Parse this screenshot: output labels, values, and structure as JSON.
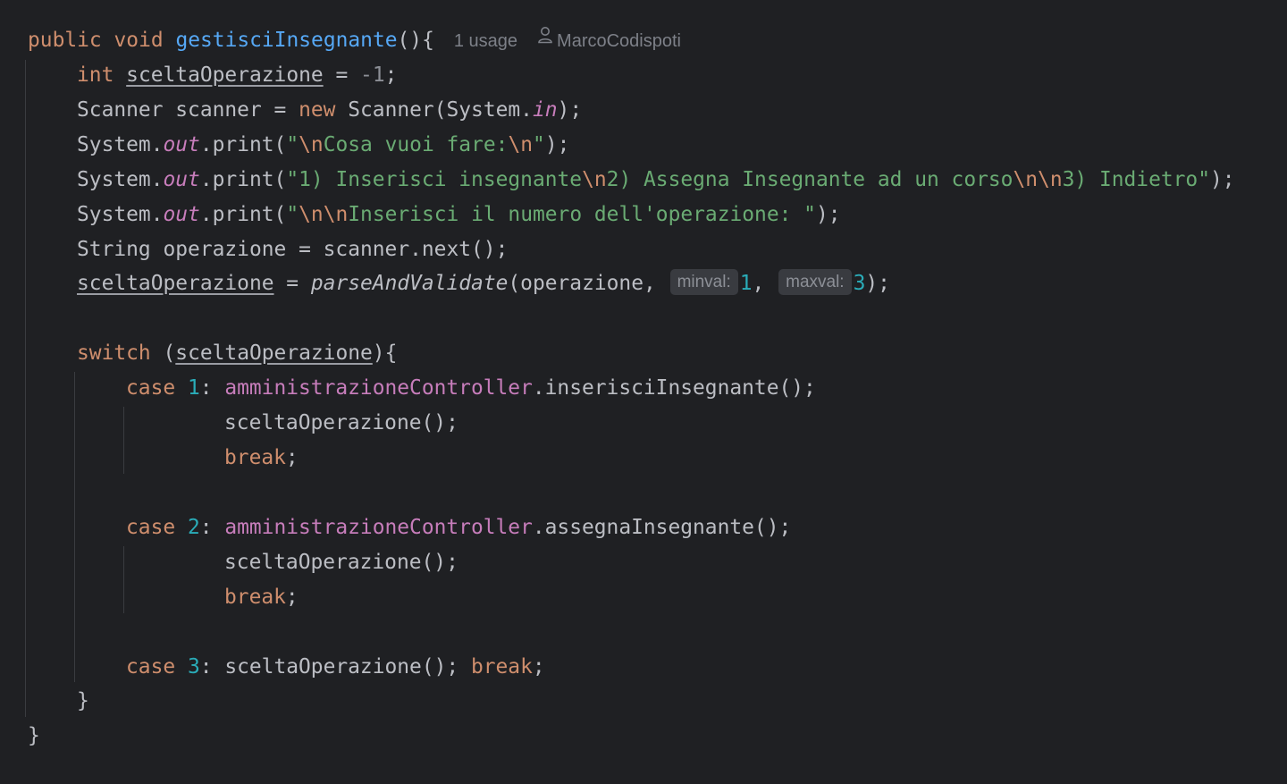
{
  "method": {
    "kw_public": "public",
    "kw_void": "void",
    "name": "gestisciInsegnante",
    "parens_open": "(){",
    "usage_hint": "1 usage",
    "author_hint": "MarcoCodispoti"
  },
  "l2": {
    "kw": "int",
    "var": "sceltaOperazione",
    "op": " = ",
    "val": "-1",
    "end": ";"
  },
  "l3": {
    "a": "Scanner scanner = ",
    "kw": "new",
    "b": " Scanner(System.",
    "static": "in",
    "end": ");"
  },
  "l4": {
    "a": "System.",
    "static": "out",
    "b": ".print(",
    "q1": "\"",
    "e1": "\\n",
    "s": "Cosa vuoi fare:",
    "e2": "\\n",
    "q2": "\"",
    "end": ");"
  },
  "l5": {
    "a": "System.",
    "static": "out",
    "b": ".print(",
    "s1": "\"1) Inserisci insegnante",
    "e1": "\\n",
    "s2": "2) Assegna Insegnante ad un corso",
    "e2": "\\n\\n",
    "s3": "3) Indietro\"",
    "end": ");"
  },
  "l6": {
    "a": "System.",
    "static": "out",
    "b": ".print(",
    "q1": "\"",
    "e1": "\\n\\n",
    "s": "Inserisci il numero dell'operazione: \"",
    "end": ");"
  },
  "l7": {
    "text": "String operazione = scanner.next();"
  },
  "l8": {
    "var": "sceltaOperazione",
    "op": " = ",
    "fn": "parseAndValidate",
    "a": "(operazione, ",
    "hint1": "minval:",
    "v1": "1",
    "comma": ", ",
    "hint2": "maxval:",
    "v2": "3",
    "end": ");"
  },
  "l9": {
    "kw": "switch",
    "a": " (",
    "var": "sceltaOperazione",
    "end": "){"
  },
  "case1": {
    "kw": "case",
    "num": "1",
    "colon": ": ",
    "field": "amministrazioneController",
    "call": ".inserisciInsegnante();",
    "body1": "sceltaOperazione();",
    "brk": "break",
    "semi": ";"
  },
  "case2": {
    "kw": "case",
    "num": "2",
    "colon": ": ",
    "field": "amministrazioneController",
    "call": ".assegnaInsegnante();",
    "body1": "sceltaOperazione();",
    "brk": "break",
    "semi": ";"
  },
  "case3": {
    "kw": "case",
    "num": "3",
    "colon": ": ",
    "call": "sceltaOperazione(); ",
    "brk": "break",
    "semi": ";"
  },
  "close_switch": "}",
  "close_method": "}",
  "colors": {
    "background": "#1f2023",
    "keyword": "#cf8e6d",
    "method_declaration": "#56a8f5",
    "number": "#2aacb8",
    "string": "#6aab73",
    "static_field": "#c77dbb",
    "default_text": "#bcbec4",
    "hint": "#7d8088"
  },
  "icons": {
    "author": "person-icon"
  }
}
